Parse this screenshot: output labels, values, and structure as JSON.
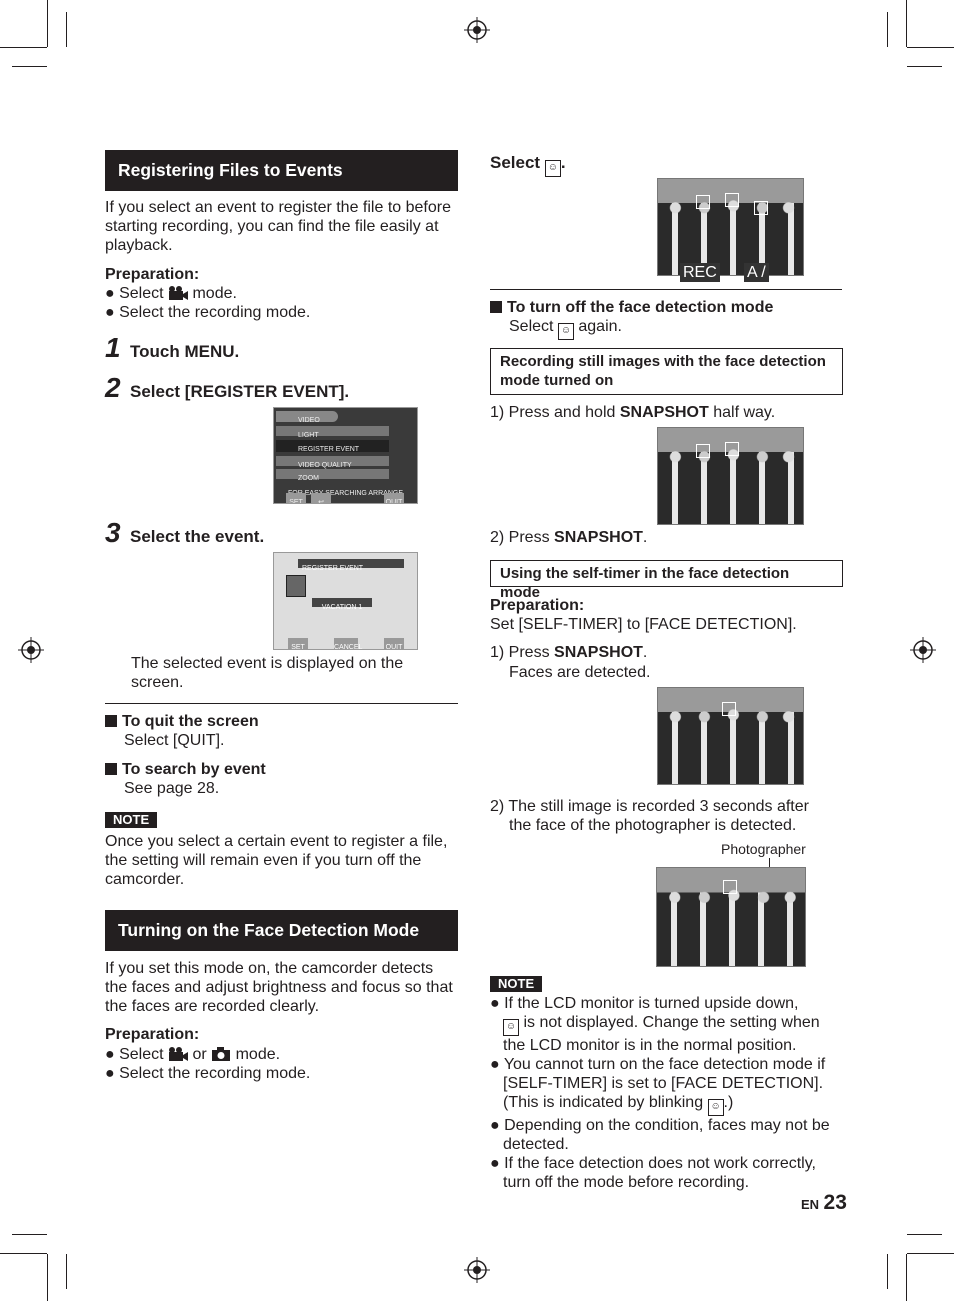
{
  "left": {
    "section1": {
      "title": "Registering Files to Events",
      "intro": "If you select an event to register the file to before starting recording, you can find the file easily at playback.",
      "prep_label": "Preparation:",
      "prep_items": [
        {
          "pre": "Select ",
          "post": " mode."
        },
        {
          "pre": "Select the recording mode.",
          "post": ""
        }
      ],
      "steps": [
        {
          "num": "1",
          "text": "Touch MENU."
        },
        {
          "num": "2",
          "text": "Select [REGISTER EVENT]."
        },
        {
          "num": "3",
          "text": "Select the event."
        }
      ],
      "menu_lcd": {
        "header": "VIDEO",
        "items": [
          "LIGHT",
          "REGISTER EVENT",
          "VIDEO QUALITY",
          "ZOOM"
        ],
        "hint": "FOR EASY SEARCHING ARRANGE",
        "buttons": [
          "SET",
          "↩",
          "QUIT"
        ]
      },
      "event_lcd": {
        "header": "REGISTER EVENT",
        "event": "VACATION 1",
        "buttons": [
          "SET",
          "CANCEL",
          "QUIT"
        ]
      },
      "step3_note": "The selected event is displayed on the screen.",
      "quit_title": "To quit the screen",
      "quit_text": "Select [QUIT].",
      "search_title": "To search by event",
      "search_text": "See page 28.",
      "note_label": "NOTE",
      "note_text": "Once you select a certain event to register a file, the setting will remain even if you turn off the camcorder."
    },
    "section2": {
      "title": "Turning on the Face Detection Mode",
      "intro": "If you set this mode on, the camcorder detects the faces and adjust brightness and focus so that the faces are recorded clearly.",
      "prep_label": "Preparation:",
      "prep_items": [
        {
          "pre": "Select ",
          "mid": " or ",
          "post": " mode."
        },
        {
          "pre": "Select the recording mode."
        }
      ]
    }
  },
  "right": {
    "select_label": "Select",
    "photo1_labels": [
      "REC",
      "A / "
    ],
    "turnoff_title": "To turn off the face detection mode",
    "turnoff_pre": "Select",
    "turnoff_post": "again.",
    "box1": "Recording still images with the face detection mode turned on",
    "s1_pre": "1) Press and hold ",
    "s1_bold": "SNAPSHOT",
    "s1_post": " half way.",
    "s2_pre": "2) Press ",
    "s2_bold": "SNAPSHOT",
    "s2_post": ".",
    "box2": "Using the self-timer in the face detection mode",
    "prep_label": "Preparation:",
    "prep_text": "Set [SELF-TIMER] to [FACE DETECTION].",
    "t1_pre": "1) Press ",
    "t1_bold": "SNAPSHOT",
    "t1_post": ".",
    "t1_sub": "Faces are detected.",
    "t2": "2) The still image is recorded 3 seconds after the face of the photographer is detected.",
    "photographer_label": "Photographer",
    "note_label": "NOTE",
    "notes": [
      {
        "a": "If the LCD monitor is turned upside down,",
        "b": " is not displayed. Change the setting when the LCD monitor is in the normal position."
      },
      {
        "a": "You cannot turn on the face detection mode if [SELF-TIMER] is set to [FACE DETECTION]. (This is indicated by blinking ",
        "b": ".)"
      },
      {
        "a": "Depending on the condition, faces may not be detected."
      },
      {
        "a": "If the face detection does not work correctly, turn off the mode before recording."
      }
    ]
  },
  "footer": {
    "lang": "EN",
    "page": "23"
  }
}
